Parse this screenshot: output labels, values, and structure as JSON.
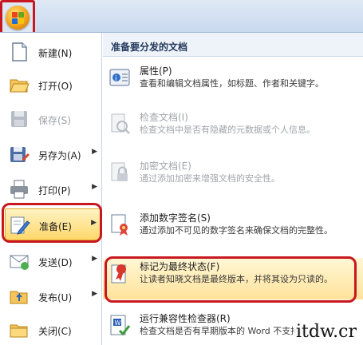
{
  "menu": {
    "left_items": [
      {
        "label": "新建(N)",
        "icon": "new-document-icon",
        "disabled": false,
        "submenu": false
      },
      {
        "label": "打开(O)",
        "icon": "open-folder-icon",
        "disabled": false,
        "submenu": false
      },
      {
        "label": "保存(S)",
        "icon": "save-disk-icon",
        "disabled": true,
        "submenu": false
      },
      {
        "label": "另存为(A)",
        "icon": "save-as-icon",
        "disabled": false,
        "submenu": true
      },
      {
        "label": "打印(P)",
        "icon": "printer-icon",
        "disabled": false,
        "submenu": true
      },
      {
        "label": "准备(E)",
        "icon": "prepare-pen-icon",
        "disabled": false,
        "submenu": true,
        "active": true
      },
      {
        "label": "发送(D)",
        "icon": "send-icon",
        "disabled": false,
        "submenu": true
      },
      {
        "label": "发布(U)",
        "icon": "publish-folder-icon",
        "disabled": false,
        "submenu": true
      },
      {
        "label": "关闭(C)",
        "icon": "close-folder-icon",
        "disabled": false,
        "submenu": false
      }
    ],
    "right_header": "准备要分发的文档",
    "right_items": [
      {
        "title": "属性(P)",
        "desc": "查看和编辑文档属性，如标题、作者和关键字。",
        "icon": "properties-icon",
        "disabled": false
      },
      {
        "title": "检查文档(I)",
        "desc": "检查文档中是否有隐藏的元数据或个人信息。",
        "icon": "inspect-document-icon",
        "disabled": true
      },
      {
        "title": "加密文档(E)",
        "desc": "通过添加加密来增强文档的安全性。",
        "icon": "encrypt-lock-icon",
        "disabled": true
      },
      {
        "title": "添加数字签名(S)",
        "desc": "通过添加不可见的数字签名来确保文档的完整性。",
        "icon": "digital-signature-icon",
        "disabled": false
      },
      {
        "title": "标记为最终状态(F)",
        "desc": "让读者知晓文档是最终版本，并将其设为只读的。",
        "icon": "mark-final-icon",
        "disabled": false,
        "highlighted": true
      },
      {
        "title": "运行兼容性检查器(R)",
        "desc": "检查文档是否有早期版本的 Word 不支持的功能。",
        "icon": "compatibility-checker-icon",
        "disabled": false
      }
    ]
  },
  "watermark": "itdw.cr"
}
